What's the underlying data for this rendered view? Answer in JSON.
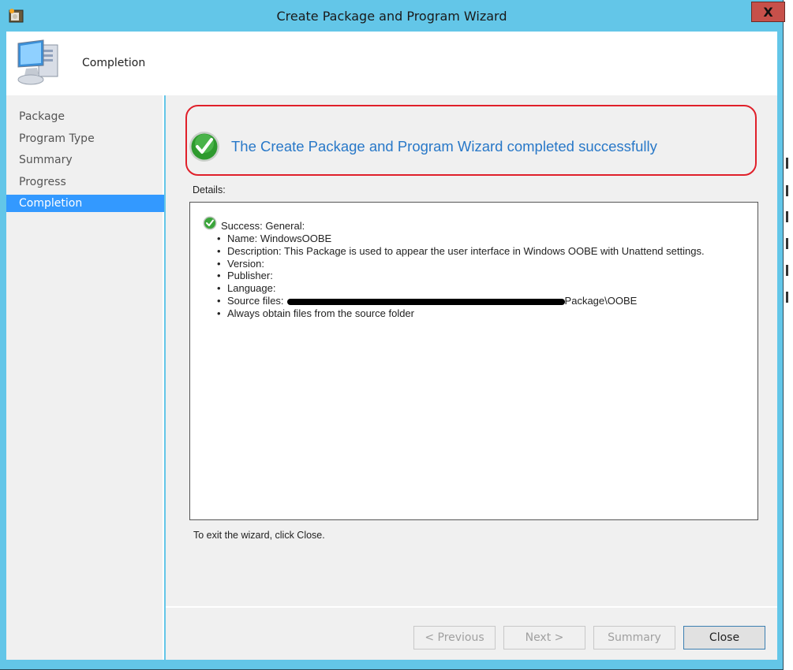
{
  "window": {
    "title": "Create Package and Program Wizard",
    "close_label": "X",
    "accent_color": "#63c6e8",
    "close_color": "#c7504a"
  },
  "header": {
    "title": "Completion",
    "icon": "computer-icon"
  },
  "sidebar": {
    "items": [
      {
        "label": "Package",
        "active": false
      },
      {
        "label": "Program Type",
        "active": false
      },
      {
        "label": "Summary",
        "active": false
      },
      {
        "label": "Progress",
        "active": false
      },
      {
        "label": "Completion",
        "active": true
      }
    ],
    "active_color": "#3399ff"
  },
  "main": {
    "banner_text": "The Create Package and Program Wizard completed successfully",
    "banner_icon": "success-check-icon",
    "banner_text_color": "#2878c8",
    "highlight_color": "#e0202a",
    "details_label": "Details:",
    "details": {
      "heading": "Success: General:",
      "items": [
        {
          "text": "Name: WindowsOOBE"
        },
        {
          "text": "Description: This Package is used to appear the user interface in Windows OOBE with Unattend settings."
        },
        {
          "text": "Version:"
        },
        {
          "text": "Publisher:"
        },
        {
          "text": "Language:"
        },
        {
          "text": "Source files:",
          "redacted": true,
          "suffix": "Package\\OOBE"
        },
        {
          "text": "Always obtain files from the source folder"
        }
      ]
    },
    "exit_text": "To exit the wizard, click Close."
  },
  "footer": {
    "buttons": [
      {
        "label": "< Previous",
        "enabled": false
      },
      {
        "label": "Next >",
        "enabled": false
      },
      {
        "label": "Summary",
        "enabled": false
      },
      {
        "label": "Close",
        "enabled": true
      }
    ]
  }
}
